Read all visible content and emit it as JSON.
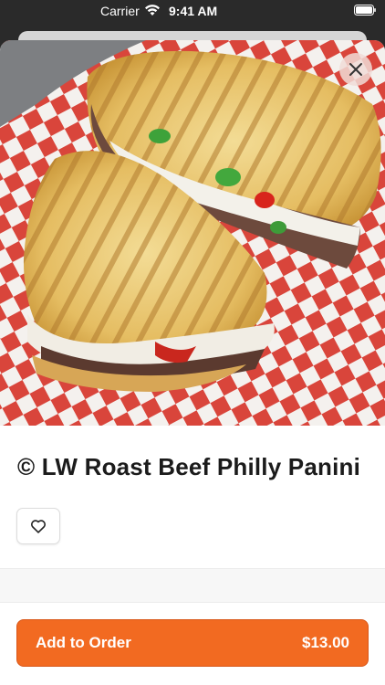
{
  "status_bar": {
    "carrier": "Carrier",
    "time": "9:41 AM"
  },
  "item": {
    "title": "© LW Roast Beef Philly Panini",
    "image_icon": "sandwich-photo"
  },
  "actions": {
    "add_to_order_label": "Add to Order",
    "price": "$13.00"
  },
  "icons": {
    "close": "close-icon",
    "favorite": "heart-icon",
    "wifi": "wifi-icon",
    "battery": "battery-icon"
  },
  "colors": {
    "accent": "#f26a21",
    "checker_red": "#d9453b",
    "checker_white": "#f4f1ee"
  }
}
